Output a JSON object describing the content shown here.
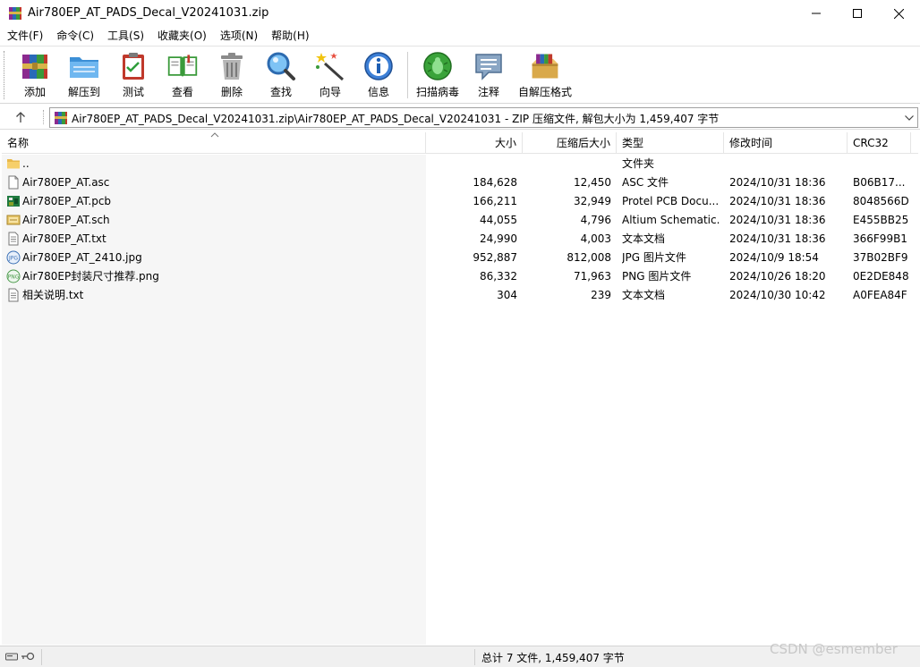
{
  "window": {
    "title": "Air780EP_AT_PADS_Decal_V20241031.zip"
  },
  "menu": [
    "文件(F)",
    "命令(C)",
    "工具(S)",
    "收藏夹(O)",
    "选项(N)",
    "帮助(H)"
  ],
  "toolbar": {
    "add": "添加",
    "extract": "解压到",
    "test": "测试",
    "view": "查看",
    "delete": "删除",
    "find": "查找",
    "wizard": "向导",
    "info": "信息",
    "scan": "扫描病毒",
    "comment": "注释",
    "sfx": "自解压格式"
  },
  "address": {
    "path": "Air780EP_AT_PADS_Decal_V20241031.zip\\Air780EP_AT_PADS_Decal_V20241031 - ZIP 压缩文件, 解包大小为 1,459,407 字节"
  },
  "columns": {
    "name": "名称",
    "size": "大小",
    "packed": "压缩后大小",
    "type": "类型",
    "modified": "修改时间",
    "crc": "CRC32"
  },
  "files": [
    {
      "name": "..",
      "size": "",
      "packed": "",
      "type": "文件夹",
      "modified": "",
      "crc": "",
      "icon": "folder-icon"
    },
    {
      "name": "Air780EP_AT.asc",
      "size": "184,628",
      "packed": "12,450",
      "type": "ASC 文件",
      "modified": "2024/10/31 18:36",
      "crc": "B06B17...",
      "icon": "blank-file-icon"
    },
    {
      "name": "Air780EP_AT.pcb",
      "size": "166,211",
      "packed": "32,949",
      "type": "Protel PCB Docu...",
      "modified": "2024/10/31 18:36",
      "crc": "8048566D",
      "icon": "pcb-file-icon"
    },
    {
      "name": "Air780EP_AT.sch",
      "size": "44,055",
      "packed": "4,796",
      "type": "Altium Schematic...",
      "modified": "2024/10/31 18:36",
      "crc": "E455BB25",
      "icon": "schematic-file-icon"
    },
    {
      "name": "Air780EP_AT.txt",
      "size": "24,990",
      "packed": "4,003",
      "type": "文本文档",
      "modified": "2024/10/31 18:36",
      "crc": "366F99B1",
      "icon": "text-file-icon"
    },
    {
      "name": "Air780EP_AT_2410.jpg",
      "size": "952,887",
      "packed": "812,008",
      "type": "JPG 图片文件",
      "modified": "2024/10/9 18:54",
      "crc": "37B02BF9",
      "icon": "jpg-file-icon"
    },
    {
      "name": "Air780EP封装尺寸推荐.png",
      "size": "86,332",
      "packed": "71,963",
      "type": "PNG 图片文件",
      "modified": "2024/10/26 18:20",
      "crc": "0E2DE848",
      "icon": "png-file-icon"
    },
    {
      "name": "相关说明.txt",
      "size": "304",
      "packed": "239",
      "type": "文本文档",
      "modified": "2024/10/30 10:42",
      "crc": "A0FEA84F",
      "icon": "text-file-icon"
    }
  ],
  "status": {
    "summary": "总计 7 文件, 1,459,407 字节"
  },
  "watermark": "CSDN @esmember"
}
